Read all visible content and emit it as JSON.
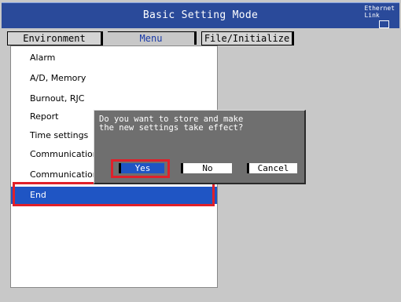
{
  "window": {
    "title": "Basic Setting Mode"
  },
  "status": {
    "ethernet_line1": "Ethernet",
    "ethernet_line2": "Link"
  },
  "tabs": [
    {
      "label": "Environment"
    },
    {
      "label": "Menu"
    },
    {
      "label": "File/Initialize"
    }
  ],
  "menu": {
    "items": [
      {
        "label": "Alarm"
      },
      {
        "label": "A/D, Memory"
      },
      {
        "label": "Burnout, RJC"
      },
      {
        "label": "Report"
      },
      {
        "label": "Time settings"
      },
      {
        "label": "Communication"
      },
      {
        "label": "Communication"
      },
      {
        "label": "End"
      }
    ],
    "selected": "End"
  },
  "dialog": {
    "message": "Do you want to store and make\nthe new settings take effect?",
    "yes_label": "Yes",
    "no_label": "No",
    "cancel_label": "Cancel"
  },
  "colors": {
    "title_bar": "#2a4a9a",
    "selection": "#1f55c4",
    "highlight_frame": "#e0202a",
    "dialog_bg": "#6f6f6f"
  }
}
